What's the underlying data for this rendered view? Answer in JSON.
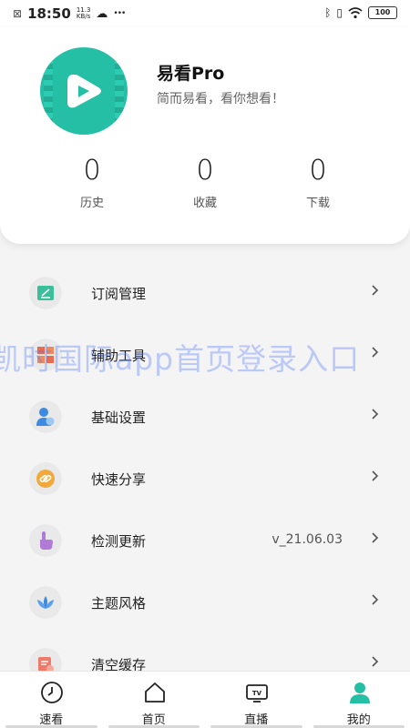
{
  "status_bar": {
    "time": "18:50",
    "speed_value": "11.3",
    "speed_unit": "KB/s",
    "dots": "•••",
    "battery": "100"
  },
  "profile": {
    "app_name": "易看Pro",
    "slogan": "简而易看，看你想看！"
  },
  "stats": [
    {
      "value": "0",
      "label": "历史"
    },
    {
      "value": "0",
      "label": "收藏"
    },
    {
      "value": "0",
      "label": "下载"
    }
  ],
  "menu": [
    {
      "label": "订阅管理",
      "icon": "subscription-icon"
    },
    {
      "label": "辅助工具",
      "icon": "tools-icon"
    },
    {
      "label": "基础设置",
      "icon": "settings-user-icon"
    },
    {
      "label": "快速分享",
      "icon": "share-link-icon"
    },
    {
      "label": "检测更新",
      "icon": "update-hand-icon",
      "value": "v_21.06.03"
    },
    {
      "label": "主题风格",
      "icon": "theme-lotus-icon"
    },
    {
      "label": "清空缓存",
      "icon": "clear-cache-icon"
    }
  ],
  "watermark": "凯时国际app首页登录入口",
  "bottom_nav": [
    {
      "label": "速看",
      "icon": "clock-icon"
    },
    {
      "label": "首页",
      "icon": "home-icon"
    },
    {
      "label": "直播",
      "icon": "tv-icon"
    },
    {
      "label": "我的",
      "icon": "user-icon",
      "active": true
    }
  ],
  "colors": {
    "accent": "#25bfa6",
    "background": "#f4f4f4"
  }
}
